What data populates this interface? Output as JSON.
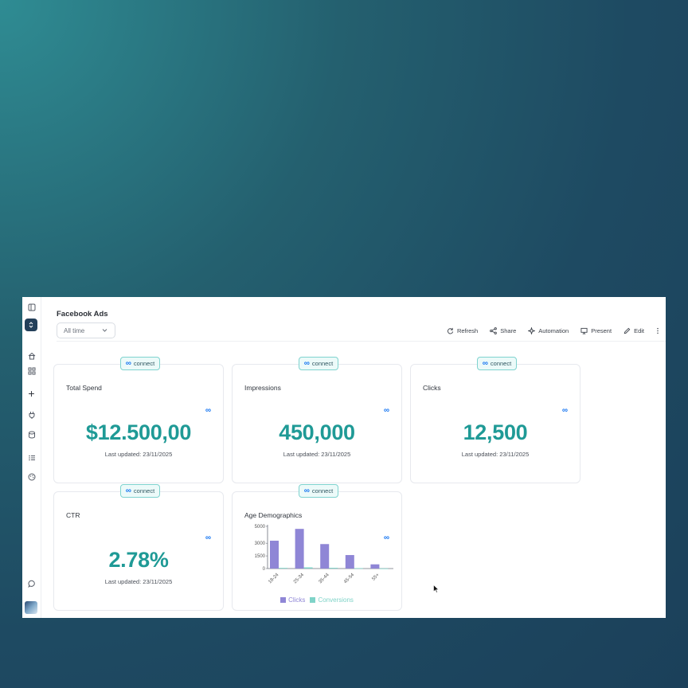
{
  "page": {
    "title": "Facebook Ads"
  },
  "filters": {
    "date_range": "All time"
  },
  "toolbar": {
    "refresh": "Refresh",
    "share": "Share",
    "automation": "Automation",
    "present": "Present",
    "edit": "Edit"
  },
  "connect_label": "connect",
  "cards": [
    {
      "title": "Total Spend",
      "value": "$12.500,00",
      "updated": "Last updated: 23/11/2025"
    },
    {
      "title": "Impressions",
      "value": "450,000",
      "updated": "Last updated: 23/11/2025"
    },
    {
      "title": "Clicks",
      "value": "12,500",
      "updated": "Last updated: 23/11/2025"
    },
    {
      "title": "CTR",
      "value": "2.78%",
      "updated": "Last updated: 23/11/2025"
    }
  ],
  "age_card": {
    "title": "Age Demographics"
  },
  "colors": {
    "accent": "#1f9a96",
    "clicks": "#8f86d6",
    "conversions": "#7fd3c8",
    "brand_dark": "#24405a"
  },
  "chart_data": {
    "type": "bar",
    "title": "Age Demographics",
    "categories": [
      "18-24",
      "25-34",
      "35-44",
      "45-54",
      "55+"
    ],
    "series": [
      {
        "name": "Clicks",
        "values": [
          3300,
          4700,
          2900,
          1600,
          500
        ]
      },
      {
        "name": "Conversions",
        "values": [
          80,
          140,
          90,
          50,
          20
        ]
      }
    ],
    "yticks": [
      "0",
      "1500",
      "3000",
      "5000"
    ],
    "ylim": [
      0,
      5000
    ],
    "legend": "bottom"
  }
}
